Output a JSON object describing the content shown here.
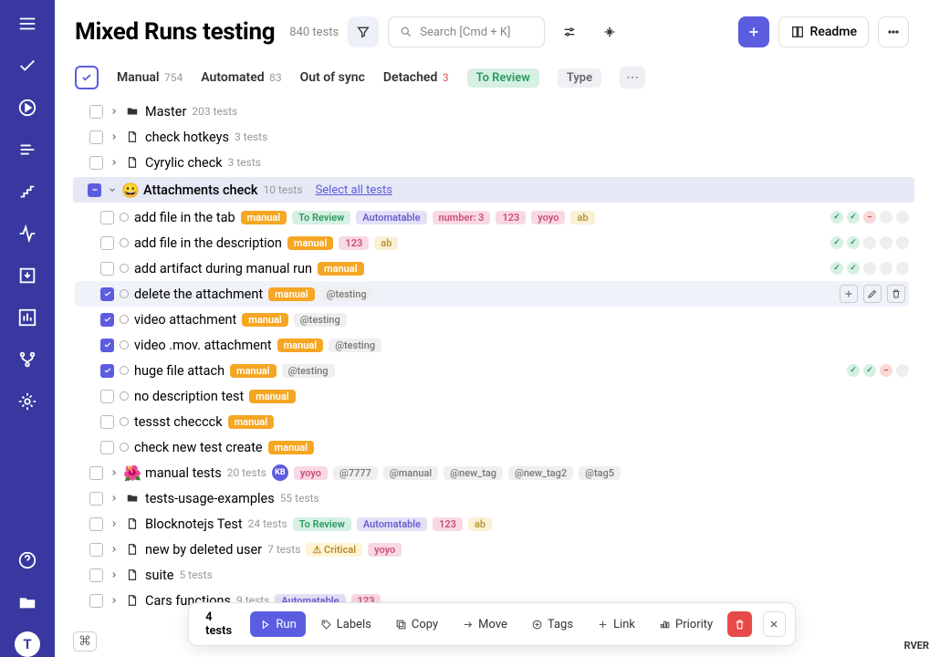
{
  "header": {
    "title": "Mixed Runs testing",
    "total_count": "840 tests",
    "search_placeholder": "Search [Cmd + K]",
    "readme": "Readme"
  },
  "filter": {
    "manual": "Manual",
    "manual_count": "754",
    "automated": "Automated",
    "automated_count": "83",
    "out_of_sync": "Out of sync",
    "detached": "Detached",
    "detached_count": "3",
    "to_review": "To Review",
    "type": "Type"
  },
  "groups": [
    {
      "icon": "folder",
      "title": "Master",
      "count": "203 tests"
    },
    {
      "icon": "file",
      "title": "check hotkeys",
      "count": "3 tests"
    },
    {
      "icon": "file",
      "title": "Cyrylic check",
      "count": "3 tests"
    }
  ],
  "expanded_group": {
    "emoji": "😀",
    "title": "Attachments check",
    "count": "10 tests",
    "select_all": "Select all tests"
  },
  "tests": [
    {
      "title": "add file in the tab",
      "tags": [
        "manual",
        "To Review",
        "Automatable",
        "number: 3",
        "123",
        "yoyo",
        "ab"
      ],
      "status": [
        "green",
        "green",
        "red",
        "gray",
        "gray"
      ]
    },
    {
      "title": "add file in the description",
      "tags": [
        "manual",
        "123",
        "ab"
      ],
      "status": [
        "green",
        "green",
        "gray",
        "gray",
        "gray"
      ]
    },
    {
      "title": "add artifact during manual run",
      "tags": [
        "manual"
      ],
      "status": [
        "green",
        "green",
        "gray",
        "gray",
        "gray"
      ]
    },
    {
      "title": "delete the attachment",
      "tags": [
        "manual",
        "@testing"
      ],
      "checked": true,
      "hover": true
    },
    {
      "title": "video attachment",
      "tags": [
        "manual",
        "@testing"
      ],
      "checked": true
    },
    {
      "title": "video .mov. attachment",
      "tags": [
        "manual",
        "@testing"
      ],
      "checked": true
    },
    {
      "title": "huge file attach",
      "tags": [
        "manual",
        "@testing"
      ],
      "checked": true,
      "status": [
        "green",
        "green",
        "red",
        "gray"
      ]
    },
    {
      "title": "no description test",
      "tags": [
        "manual"
      ]
    },
    {
      "title": "tessst checcck",
      "tags": [
        "manual"
      ]
    },
    {
      "title": "check new test create",
      "tags": [
        "manual"
      ]
    }
  ],
  "groups_after": [
    {
      "emoji": "🌺",
      "title": "manual tests",
      "count": "20 tests",
      "kb": "KB",
      "tags": [
        "yoyo",
        "@7777",
        "@manual",
        "@new_tag",
        "@new_tag2",
        "@tag5"
      ]
    },
    {
      "icon": "folder",
      "title": "tests-usage-examples",
      "count": "55 tests"
    },
    {
      "icon": "file",
      "title": "Blocknotejs Test",
      "count": "24 tests",
      "tags": [
        "To Review",
        "Automatable",
        "123",
        "ab"
      ]
    },
    {
      "icon": "file",
      "title": "new by deleted user",
      "count": "7 tests",
      "tags": [
        "⚠ Critical",
        "yoyo"
      ]
    },
    {
      "icon": "file",
      "title": "suite",
      "count": "5 tests"
    },
    {
      "icon": "file",
      "title": "Cars functions",
      "count": "9 tests",
      "tags": [
        "Automatable",
        "123"
      ]
    }
  ],
  "action_bar": {
    "selected": "4 tests",
    "run": "Run",
    "labels": "Labels",
    "copy": "Copy",
    "move": "Move",
    "tags": "Tags",
    "link": "Link",
    "priority": "Priority"
  },
  "cmd": "⌘",
  "rver": "RVER"
}
